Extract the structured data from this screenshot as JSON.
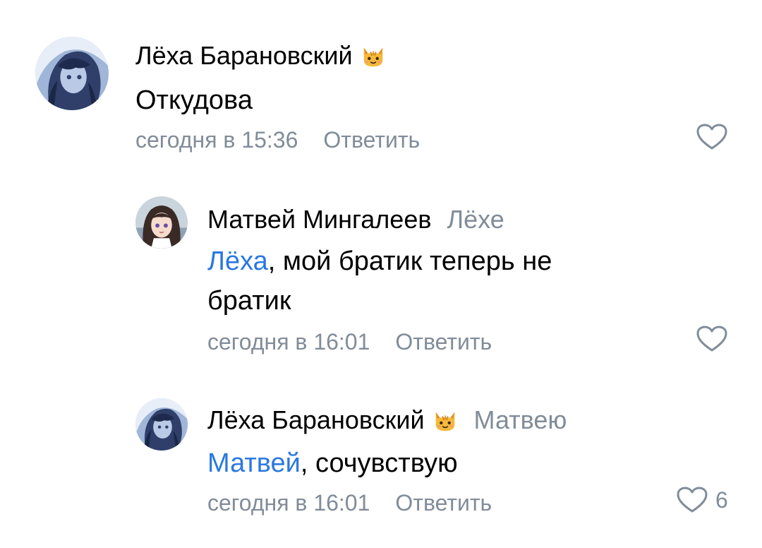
{
  "comments": [
    {
      "author": "Лёха Барановский",
      "author_badge_icon": "cat-face-emoji",
      "reply_to": "",
      "mention": "",
      "text": "Откудова",
      "time": "сегодня в 15:36",
      "reply_label": "Ответить",
      "likes": ""
    },
    {
      "author": "Матвей Мингалеев",
      "author_badge_icon": "",
      "reply_to": "Лёхе",
      "mention": "Лёха",
      "text": ", мой братик теперь не братик",
      "time": "сегодня в 16:01",
      "reply_label": "Ответить",
      "likes": ""
    },
    {
      "author": "Лёха Барановский",
      "author_badge_icon": "cat-face-emoji",
      "reply_to": "Матвею",
      "mention": "Матвей",
      "text": ", сочувствую",
      "time": "сегодня в 16:01",
      "reply_label": "Ответить",
      "likes": "6"
    }
  ],
  "colors": {
    "text": "#000000",
    "secondary": "#818c99",
    "mention": "#2a78e0",
    "background": "#ffffff"
  },
  "icons": {
    "like": "heart-outline-icon",
    "badge": "cat-face-emoji",
    "avatar_1": "anime-girl-dark-blue-avatar",
    "avatar_2": "anime-girl-brown-hair-avatar"
  }
}
